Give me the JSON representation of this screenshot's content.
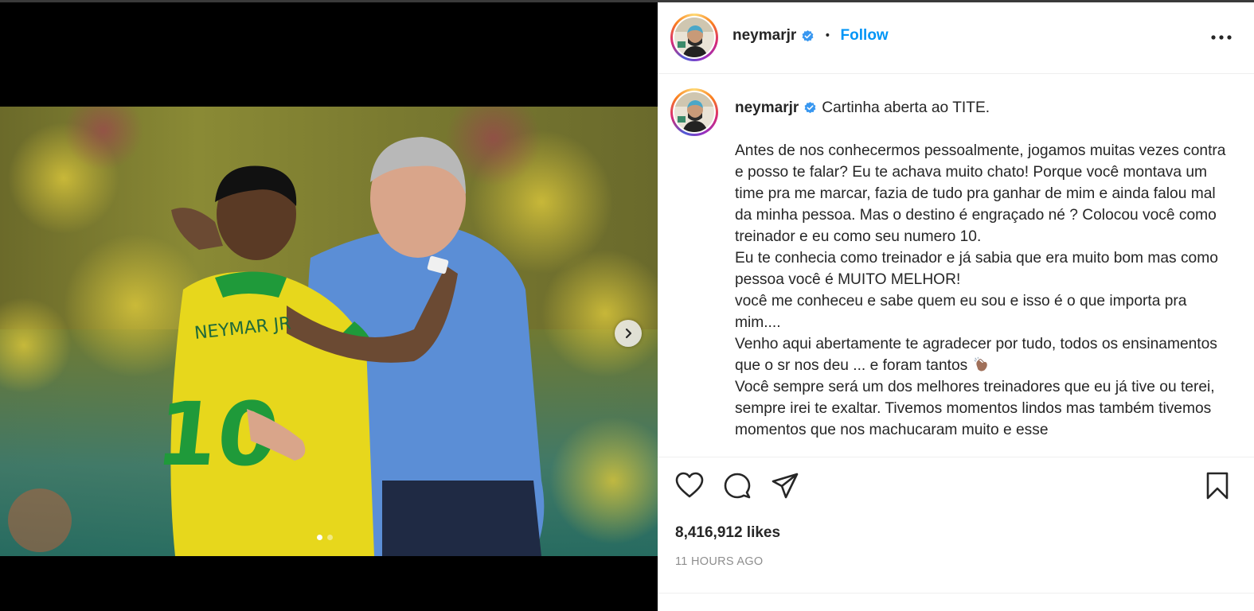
{
  "post": {
    "username": "neymarjr",
    "follow_label": "Follow",
    "separator": "•",
    "caption_title": "Cartinha aberta ao TITE.",
    "caption_paragraphs": [
      "Antes de nos conhecermos pessoalmente, jogamos muitas vezes contra e posso te falar? Eu te achava muito chato! Porque você montava um time pra me marcar, fazia de tudo pra ganhar de mim e ainda falou mal da minha pessoa. Mas o destino é engraçado né ? Colocou você como treinador e eu como seu numero 10.",
      "Eu te conhecia como treinador e já sabia que era muito bom mas como pessoa você é MUITO MELHOR!",
      "você me conheceu e sabe quem eu sou e isso é o que importa pra mim....",
      "Venho aqui abertamente te agradecer por tudo, todos os ensinamentos que o sr nos deu ... e foram tantos",
      "Você sempre será um dos melhores treinadores que eu já tive ou terei, sempre irei te exaltar. Tivemos momentos lindos mas também tivemos momentos que nos machucaram muito e esse"
    ],
    "likes": "8,416,912 likes",
    "timestamp": "11 HOURS AGO",
    "carousel": {
      "total": 2,
      "current": 1
    }
  },
  "icons": {
    "verified": "verified-badge-icon",
    "more": "more-options-icon",
    "like": "heart-icon",
    "comment": "comment-icon",
    "share": "share-icon",
    "save": "bookmark-icon",
    "next": "chevron-right-icon",
    "clap": "clapping-hands-emoji"
  },
  "colors": {
    "follow": "#0095f6",
    "verified": "#3897f0",
    "text": "#262626",
    "muted": "#8e8e8e"
  }
}
